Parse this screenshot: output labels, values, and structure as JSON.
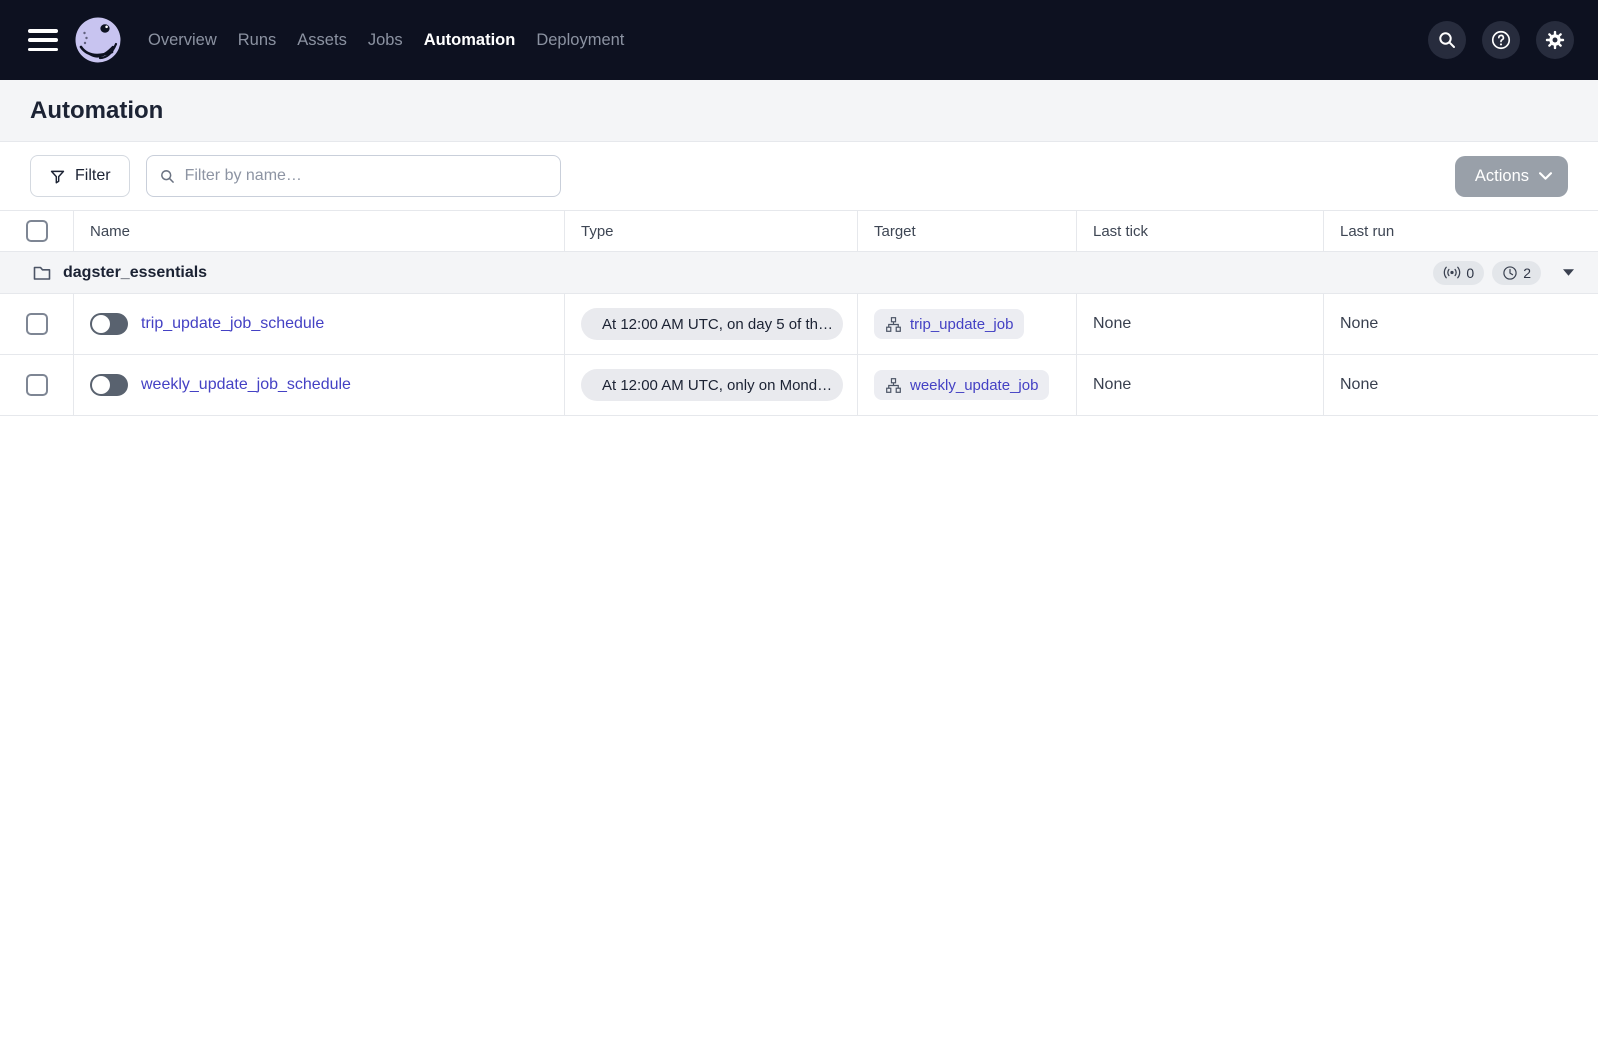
{
  "nav": {
    "items": [
      {
        "label": "Overview",
        "active": false
      },
      {
        "label": "Runs",
        "active": false
      },
      {
        "label": "Assets",
        "active": false
      },
      {
        "label": "Jobs",
        "active": false
      },
      {
        "label": "Automation",
        "active": true
      },
      {
        "label": "Deployment",
        "active": false
      }
    ],
    "right_icons": [
      "search-icon",
      "help-icon",
      "settings-icon"
    ]
  },
  "header": {
    "title": "Automation"
  },
  "toolbar": {
    "filter_label": "Filter",
    "search_placeholder": "Filter by name…",
    "search_value": "",
    "actions_label": "Actions"
  },
  "table": {
    "columns": [
      "Name",
      "Type",
      "Target",
      "Last tick",
      "Last run"
    ],
    "group": {
      "name": "dagster_essentials",
      "sensor_count": "0",
      "schedule_count": "2"
    },
    "rows": [
      {
        "name": "trip_update_job_schedule",
        "enabled": false,
        "type": "At 12:00 AM UTC, on day 5 of th…",
        "target": "trip_update_job",
        "last_tick": "None",
        "last_run": "None"
      },
      {
        "name": "weekly_update_job_schedule",
        "enabled": false,
        "type": "At 12:00 AM UTC, only on Mond…",
        "target": "weekly_update_job",
        "last_tick": "None",
        "last_run": "None"
      }
    ]
  },
  "icons": {
    "logo": "dagster-octopus-logo",
    "menu": "hamburger-icon",
    "filter": "funnel-icon",
    "group": "folder-icon",
    "sensor_badge": "sensor-signal-icon",
    "schedule_badge": "clock-icon",
    "type_cell": "clock-icon",
    "target_cell": "job-graph-icon"
  },
  "colors": {
    "nav_bg": "#0D1120",
    "nav_button_bg": "#272C3D",
    "nav_inactive_text": "#8B92A1",
    "logo_lavender": "#C8C4F0",
    "titlebar_bg": "#F4F5F7",
    "border": "#E6E8EC",
    "link": "#4441C4",
    "pill_bg": "#E9EAEE",
    "chip_bg": "#ECEDF2",
    "badge_bg": "#E3E6EA",
    "actions_button_bg": "#99A0A9",
    "toggle_track": "#59626F",
    "dark_text": "#1C2334"
  }
}
